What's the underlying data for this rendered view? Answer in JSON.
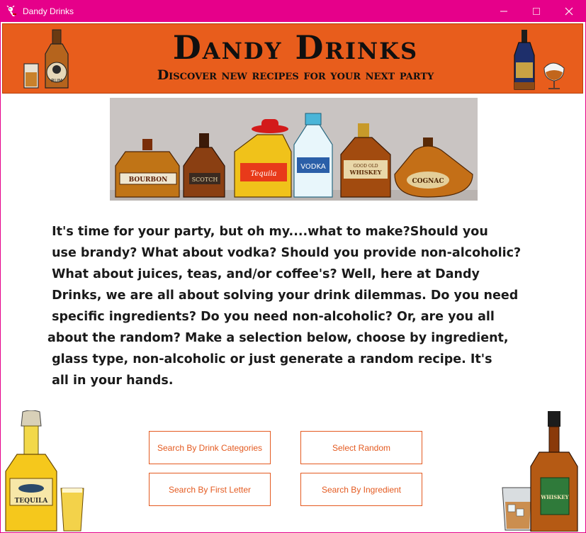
{
  "window": {
    "title": "Dandy Drinks",
    "accent": "#e6008a",
    "controls": [
      "minimize",
      "maximize",
      "close"
    ]
  },
  "banner": {
    "title": "Dandy Drinks",
    "subtitle": "Discover new recipes for your next party",
    "bottle_labels": {
      "left": "RUM",
      "right": ""
    },
    "background": "#e85d1c"
  },
  "bottles_panel": {
    "labels": [
      "BOURBON",
      "SCOTCH",
      "Tequila",
      "VODKA",
      "WHISKEY",
      "COGNAC"
    ],
    "whiskey_top": "GOOD OLD"
  },
  "intro_lines": [
    " It's time for your party, but oh my....what to make?Should you",
    " use brandy? What about vodka? Should you provide non-alcoholic?",
    " What about juices, teas, and/or coffee's? Well, here at Dandy",
    " Drinks, we are all about solving your drink dilemmas. Do you need",
    " specific ingredients? Do you need non-alcoholic? Or, are you all",
    "about the random? Make a selection below, choose by ingredient,",
    " glass type, non-alcoholic or just generate a random recipe. It's",
    " all in your hands."
  ],
  "buttons": {
    "drink_categories": "Search By Drink Categories",
    "random": "Select Random",
    "first_letter": "Search By First Letter",
    "ingredient": "Search By Ingredient",
    "color": "#e45a20"
  },
  "decor": {
    "left_bottle_label": "TEQUILA",
    "right_bottle_label": "WHISKEY"
  }
}
